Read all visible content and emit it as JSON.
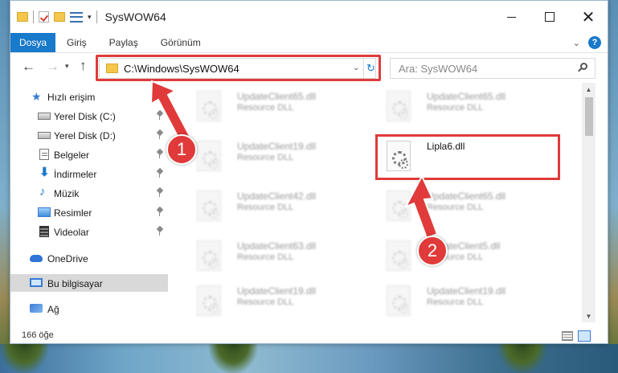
{
  "window": {
    "title": "SysWOW64",
    "controls": {
      "minimize": "minimize-icon",
      "maximize": "maximize-icon",
      "close": "✕"
    }
  },
  "ribbon": {
    "tabs": [
      {
        "label": "Dosya"
      },
      {
        "label": "Giriş"
      },
      {
        "label": "Paylaş"
      },
      {
        "label": "Görünüm"
      }
    ],
    "help": "?"
  },
  "address": {
    "path": "C:\\Windows\\SysWOW64",
    "refresh_icon": "↻"
  },
  "search": {
    "placeholder": "Ara: SysWOW64"
  },
  "nav": {
    "quick_access": "Hızlı erişim",
    "items": [
      {
        "label": "Yerel Disk (C:)",
        "icon": "drive-icon",
        "pinned": true
      },
      {
        "label": "Yerel Disk (D:)",
        "icon": "drive-icon",
        "pinned": true
      },
      {
        "label": "Belgeler",
        "icon": "documents-icon",
        "pinned": true
      },
      {
        "label": "İndirmeler",
        "icon": "downloads-icon",
        "pinned": true
      },
      {
        "label": "Müzik",
        "icon": "music-icon",
        "pinned": true
      },
      {
        "label": "Resimler",
        "icon": "pictures-icon",
        "pinned": true
      },
      {
        "label": "Videolar",
        "icon": "videos-icon",
        "pinned": true
      }
    ],
    "onedrive": "OneDrive",
    "this_pc": "Bu bilgisayar",
    "network": "Ağ"
  },
  "files": {
    "left": [
      {
        "name": "UpdateClient65.dll",
        "type": "Resource DLL"
      },
      {
        "name": "UpdateClient19.dll",
        "type": "Resource DLL"
      },
      {
        "name": "UpdateClient42.dll",
        "type": "Resource DLL"
      },
      {
        "name": "UpdateClient63.dll",
        "type": "Resource DLL"
      },
      {
        "name": "UpdateClient19.dll",
        "type": "Resource DLL"
      }
    ],
    "right": [
      {
        "name": "UpdateClient65.dll",
        "type": "Resource DLL"
      },
      {
        "name": "Lipla6.dll",
        "type": ""
      },
      {
        "name": "UpdateClient65.dll",
        "type": "Resource DLL"
      },
      {
        "name": "UpdateClient5.dll",
        "type": "Resource DLL"
      },
      {
        "name": "UpdateClient19.dll",
        "type": "Resource DLL"
      }
    ]
  },
  "status": {
    "count": "166 öğe"
  },
  "markers": {
    "one": "1",
    "two": "2"
  },
  "colors": {
    "accent": "#1979ca",
    "highlight": "#e03a3a"
  }
}
